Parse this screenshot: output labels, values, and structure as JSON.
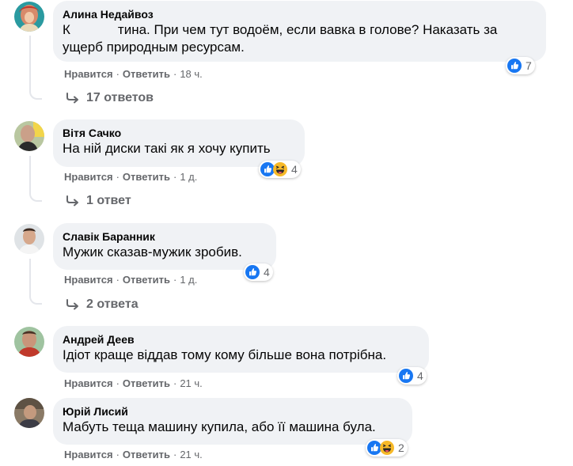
{
  "comments": [
    {
      "author": "Алина Недайвоз",
      "text_pre": "К",
      "text_post": "тина. При чем тут водоём, если вавка в голове? Наказать за",
      "text_line2": "ущерб природным ресурсам.",
      "like": "Нравится",
      "reply": "Ответить",
      "time": "18 ч.",
      "reactions": [
        "like-icon"
      ],
      "reaction_count": "7",
      "replies": "17 ответов"
    },
    {
      "author": "Вітя Сачко",
      "text": "На ній диски такі як я хочу купить",
      "like": "Нравится",
      "reply": "Ответить",
      "time": "1 д.",
      "reactions": [
        "like-icon",
        "haha-icon"
      ],
      "reaction_count": "4",
      "replies": "1 ответ"
    },
    {
      "author": "Славік Баранник",
      "text": "Мужик сказав-мужик зробив.",
      "like": "Нравится",
      "reply": "Ответить",
      "time": "1 д.",
      "reactions": [
        "like-icon"
      ],
      "reaction_count": "4",
      "replies": "2 ответа"
    },
    {
      "author": "Андрей Деев",
      "text": "Ідіот краще віддав тому кому більше вона потрібна.",
      "like": "Нравится",
      "reply": "Ответить",
      "time": "21 ч.",
      "reactions": [
        "like-icon"
      ],
      "reaction_count": "4"
    },
    {
      "author": "Юрій Лисий",
      "text": "Мабуть теща машину купила, або її машина була.",
      "like": "Нравится",
      "reply": "Ответить",
      "time": "21 ч.",
      "reactions": [
        "like-icon",
        "haha-icon"
      ],
      "reaction_count": "2"
    }
  ],
  "colors": {
    "bubble": "#f0f2f5",
    "secondary_text": "#65676b",
    "like_blue": "#1877f2",
    "haha_yellow": "#f7b928"
  }
}
